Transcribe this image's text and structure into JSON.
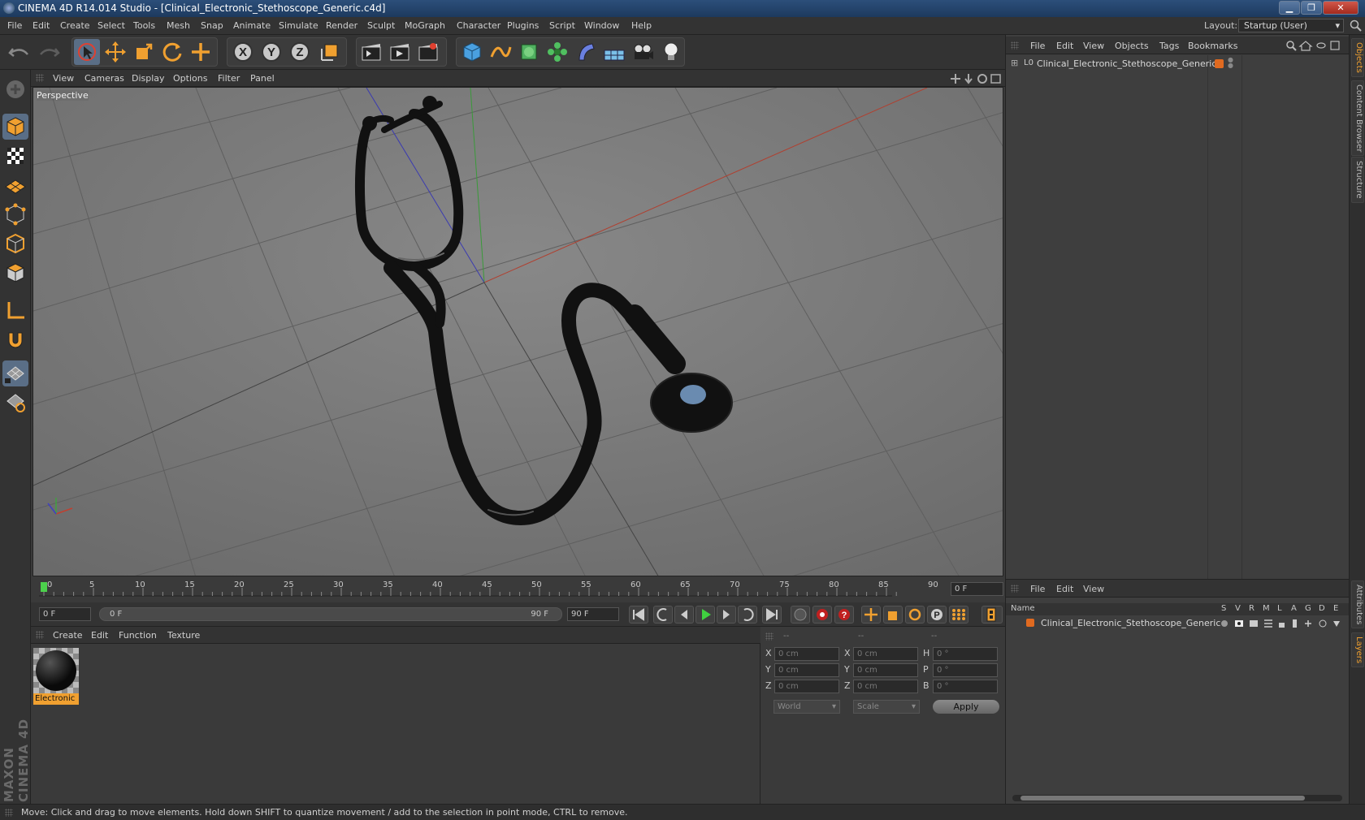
{
  "window": {
    "title": "CINEMA 4D R14.014 Studio - [Clinical_Electronic_Stethoscope_Generic.c4d]",
    "minimize": "▁",
    "maximize": "❐",
    "close": "✕"
  },
  "menubar": {
    "items": [
      "File",
      "Edit",
      "Create",
      "Select",
      "Tools",
      "Mesh",
      "Snap",
      "Animate",
      "Simulate",
      "Render",
      "Sculpt",
      "MoGraph",
      "Character",
      "Plugins",
      "Script",
      "Window",
      "Help"
    ],
    "layout_label": "Layout:",
    "layout_value": "Startup (User)"
  },
  "viewport": {
    "menu": [
      "View",
      "Cameras",
      "Display",
      "Options",
      "Filter",
      "Panel"
    ],
    "label": "Perspective"
  },
  "timeline": {
    "ticks": [
      "0",
      "5",
      "10",
      "15",
      "20",
      "25",
      "30",
      "35",
      "40",
      "45",
      "50",
      "55",
      "60",
      "65",
      "70",
      "75",
      "80",
      "85",
      "90"
    ],
    "current_frame": "0 F",
    "start_frame": "0 F",
    "range_start": "0 F",
    "range_end": "90 F",
    "end_frame": "90 F"
  },
  "material_panel": {
    "menu": [
      "Create",
      "Edit",
      "Function",
      "Texture"
    ],
    "material_name": "Electronic"
  },
  "coord_panel": {
    "headers": [
      "--",
      "--",
      "--"
    ],
    "rows": [
      {
        "a": "X",
        "av": "0 cm",
        "b": "X",
        "bv": "0 cm",
        "c": "H",
        "cv": "0 °"
      },
      {
        "a": "Y",
        "av": "0 cm",
        "b": "Y",
        "bv": "0 cm",
        "c": "P",
        "cv": "0 °"
      },
      {
        "a": "Z",
        "av": "0 cm",
        "b": "Z",
        "bv": "0 cm",
        "c": "B",
        "cv": "0 °"
      }
    ],
    "mode": "World",
    "scale": "Scale",
    "apply": "Apply"
  },
  "object_manager": {
    "menu": [
      "File",
      "Edit",
      "View",
      "Objects",
      "Tags",
      "Bookmarks"
    ],
    "object_name": "Clinical_Electronic_Stethoscope_Generic"
  },
  "layer_manager": {
    "menu": [
      "File",
      "Edit",
      "View"
    ],
    "columns": [
      "Name",
      "S",
      "V",
      "R",
      "M",
      "L",
      "A",
      "G",
      "D",
      "E"
    ],
    "layer_name": "Clinical_Electronic_Stethoscope_Generic"
  },
  "side_tabs": [
    "Objects",
    "Content Browser",
    "Structure",
    "Attributes",
    "Layers"
  ],
  "branding": "MAXON CINEMA 4D",
  "statusbar": {
    "text": "Move: Click and drag to move elements. Hold down SHIFT to quantize movement / add to the selection in point mode, CTRL to remove."
  },
  "colors": {
    "accent_orange": "#f0a030",
    "active_blue": "#5a6e86",
    "viewport_bg": "#7b7b7b",
    "layer_color": "#e06a20"
  }
}
